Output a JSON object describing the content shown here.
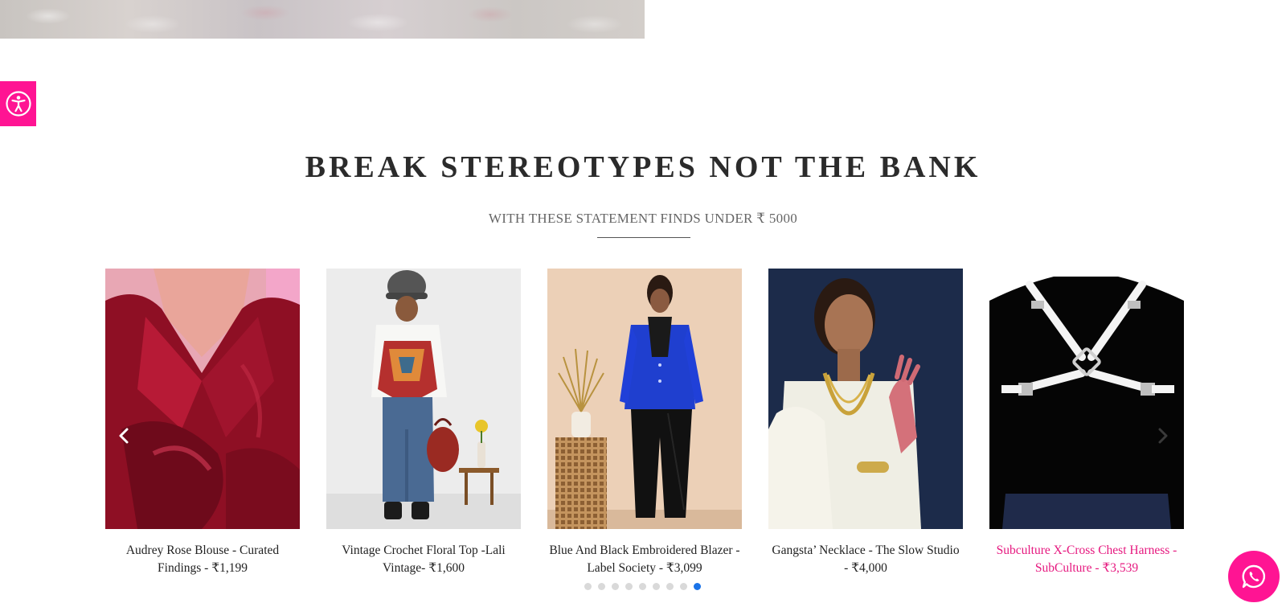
{
  "section": {
    "title": "BREAK STEREOTYPES NOT THE BANK",
    "subtitle": "WITH THESE STATEMENT FINDS UNDER ₹ 5000"
  },
  "products": [
    {
      "caption": "Audrey Rose Blouse - Curated Findings - ₹1,199"
    },
    {
      "caption": "Vintage Crochet Floral Top -Lali Vintage- ₹1,600"
    },
    {
      "caption": "Blue And Black Embroidered Blazer - Label Society - ₹3,099"
    },
    {
      "caption": "Gangsta’ Necklace - The Slow Studio - ₹4,000"
    },
    {
      "caption": "Subculture X-Cross Chest Harness - SubCulture - ₹3,539"
    }
  ],
  "carousel": {
    "page_count": 9,
    "active_page": 9
  },
  "colors": {
    "accent_pink": "#ff1493",
    "hover_text_pink": "#e6187f",
    "active_dot_blue": "#1a73e8"
  },
  "icons": {
    "accessibility": "accessibility-icon",
    "prev": "chevron-left-icon",
    "next": "chevron-right-icon",
    "whatsapp": "whatsapp-icon"
  }
}
